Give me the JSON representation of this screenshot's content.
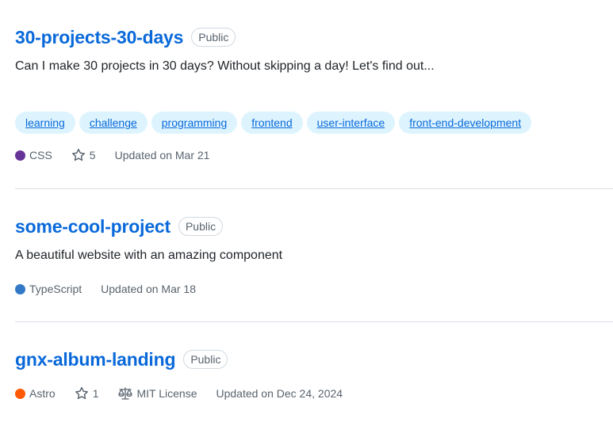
{
  "repositories": [
    {
      "name": "30-projects-30-days",
      "visibility": "Public",
      "description": "Can I make 30 projects in 30 days? Without skipping a day! Let's find out...",
      "topics": [
        "learning",
        "challenge",
        "programming",
        "frontend",
        "user-interface",
        "front-end-development"
      ],
      "language": "CSS",
      "language_color": "#663399",
      "stars": "5",
      "updated": "Updated on Mar 21"
    },
    {
      "name": "some-cool-project",
      "visibility": "Public",
      "description": "A beautiful website with an amazing component",
      "language": "TypeScript",
      "language_color": "#3178c6",
      "updated": "Updated on Mar 18"
    },
    {
      "name": "gnx-album-landing",
      "visibility": "Public",
      "language": "Astro",
      "language_color": "#ff5a03",
      "stars": "1",
      "license": "MIT License",
      "updated": "Updated on Dec 24, 2024"
    }
  ],
  "icons": {
    "star": "star-icon",
    "license": "scale-icon"
  },
  "colors": {
    "link": "#0969da",
    "topic_bg": "#ddf4ff",
    "muted": "#59636e"
  }
}
